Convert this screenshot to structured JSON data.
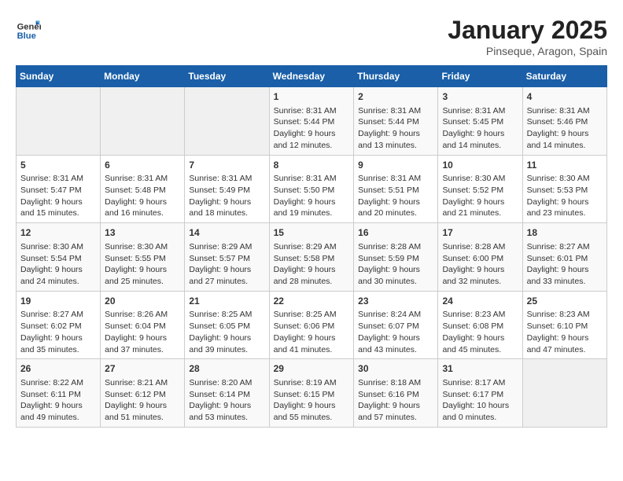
{
  "header": {
    "logo_general": "General",
    "logo_blue": "Blue",
    "month_year": "January 2025",
    "location": "Pinseque, Aragon, Spain"
  },
  "days_of_week": [
    "Sunday",
    "Monday",
    "Tuesday",
    "Wednesday",
    "Thursday",
    "Friday",
    "Saturday"
  ],
  "weeks": [
    [
      {
        "day": "",
        "empty": true
      },
      {
        "day": "",
        "empty": true
      },
      {
        "day": "",
        "empty": true
      },
      {
        "day": "1",
        "sunrise": "8:31 AM",
        "sunset": "5:44 PM",
        "daylight": "9 hours and 12 minutes."
      },
      {
        "day": "2",
        "sunrise": "8:31 AM",
        "sunset": "5:44 PM",
        "daylight": "9 hours and 13 minutes."
      },
      {
        "day": "3",
        "sunrise": "8:31 AM",
        "sunset": "5:45 PM",
        "daylight": "9 hours and 14 minutes."
      },
      {
        "day": "4",
        "sunrise": "8:31 AM",
        "sunset": "5:46 PM",
        "daylight": "9 hours and 14 minutes."
      }
    ],
    [
      {
        "day": "5",
        "sunrise": "8:31 AM",
        "sunset": "5:47 PM",
        "daylight": "9 hours and 15 minutes."
      },
      {
        "day": "6",
        "sunrise": "8:31 AM",
        "sunset": "5:48 PM",
        "daylight": "9 hours and 16 minutes."
      },
      {
        "day": "7",
        "sunrise": "8:31 AM",
        "sunset": "5:49 PM",
        "daylight": "9 hours and 18 minutes."
      },
      {
        "day": "8",
        "sunrise": "8:31 AM",
        "sunset": "5:50 PM",
        "daylight": "9 hours and 19 minutes."
      },
      {
        "day": "9",
        "sunrise": "8:31 AM",
        "sunset": "5:51 PM",
        "daylight": "9 hours and 20 minutes."
      },
      {
        "day": "10",
        "sunrise": "8:30 AM",
        "sunset": "5:52 PM",
        "daylight": "9 hours and 21 minutes."
      },
      {
        "day": "11",
        "sunrise": "8:30 AM",
        "sunset": "5:53 PM",
        "daylight": "9 hours and 23 minutes."
      }
    ],
    [
      {
        "day": "12",
        "sunrise": "8:30 AM",
        "sunset": "5:54 PM",
        "daylight": "9 hours and 24 minutes."
      },
      {
        "day": "13",
        "sunrise": "8:30 AM",
        "sunset": "5:55 PM",
        "daylight": "9 hours and 25 minutes."
      },
      {
        "day": "14",
        "sunrise": "8:29 AM",
        "sunset": "5:57 PM",
        "daylight": "9 hours and 27 minutes."
      },
      {
        "day": "15",
        "sunrise": "8:29 AM",
        "sunset": "5:58 PM",
        "daylight": "9 hours and 28 minutes."
      },
      {
        "day": "16",
        "sunrise": "8:28 AM",
        "sunset": "5:59 PM",
        "daylight": "9 hours and 30 minutes."
      },
      {
        "day": "17",
        "sunrise": "8:28 AM",
        "sunset": "6:00 PM",
        "daylight": "9 hours and 32 minutes."
      },
      {
        "day": "18",
        "sunrise": "8:27 AM",
        "sunset": "6:01 PM",
        "daylight": "9 hours and 33 minutes."
      }
    ],
    [
      {
        "day": "19",
        "sunrise": "8:27 AM",
        "sunset": "6:02 PM",
        "daylight": "9 hours and 35 minutes."
      },
      {
        "day": "20",
        "sunrise": "8:26 AM",
        "sunset": "6:04 PM",
        "daylight": "9 hours and 37 minutes."
      },
      {
        "day": "21",
        "sunrise": "8:25 AM",
        "sunset": "6:05 PM",
        "daylight": "9 hours and 39 minutes."
      },
      {
        "day": "22",
        "sunrise": "8:25 AM",
        "sunset": "6:06 PM",
        "daylight": "9 hours and 41 minutes."
      },
      {
        "day": "23",
        "sunrise": "8:24 AM",
        "sunset": "6:07 PM",
        "daylight": "9 hours and 43 minutes."
      },
      {
        "day": "24",
        "sunrise": "8:23 AM",
        "sunset": "6:08 PM",
        "daylight": "9 hours and 45 minutes."
      },
      {
        "day": "25",
        "sunrise": "8:23 AM",
        "sunset": "6:10 PM",
        "daylight": "9 hours and 47 minutes."
      }
    ],
    [
      {
        "day": "26",
        "sunrise": "8:22 AM",
        "sunset": "6:11 PM",
        "daylight": "9 hours and 49 minutes."
      },
      {
        "day": "27",
        "sunrise": "8:21 AM",
        "sunset": "6:12 PM",
        "daylight": "9 hours and 51 minutes."
      },
      {
        "day": "28",
        "sunrise": "8:20 AM",
        "sunset": "6:14 PM",
        "daylight": "9 hours and 53 minutes."
      },
      {
        "day": "29",
        "sunrise": "8:19 AM",
        "sunset": "6:15 PM",
        "daylight": "9 hours and 55 minutes."
      },
      {
        "day": "30",
        "sunrise": "8:18 AM",
        "sunset": "6:16 PM",
        "daylight": "9 hours and 57 minutes."
      },
      {
        "day": "31",
        "sunrise": "8:17 AM",
        "sunset": "6:17 PM",
        "daylight": "10 hours and 0 minutes."
      },
      {
        "day": "",
        "empty": true
      }
    ]
  ]
}
